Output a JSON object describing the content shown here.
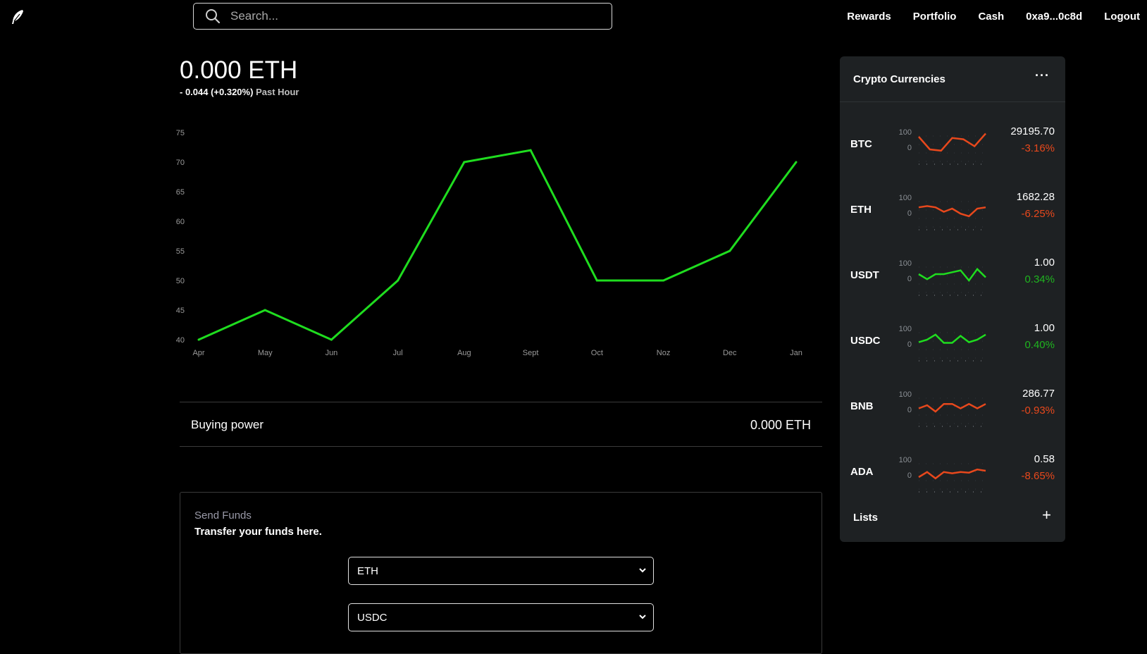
{
  "search": {
    "placeholder": "Search..."
  },
  "nav": [
    "Rewards",
    "Portfolio",
    "Cash",
    "0xa9...0c8d",
    "Logout"
  ],
  "balance": {
    "amount": "0.000 ETH",
    "change": "- 0.044 (+0.320%)",
    "period": "Past Hour"
  },
  "colors": {
    "up": "#1fdd1f",
    "down": "#e8481c",
    "background": "#000000",
    "panel": "#1e2123"
  },
  "chart_data": {
    "type": "line",
    "x": [
      "Apr",
      "May",
      "Jun",
      "Jul",
      "Aug",
      "Sept",
      "Oct",
      "Noz",
      "Dec",
      "Jan"
    ],
    "values": [
      40,
      45,
      40,
      50,
      70,
      72,
      50,
      50,
      55,
      70
    ],
    "yticks": [
      40,
      45,
      50,
      55,
      60,
      65,
      70,
      75
    ],
    "ylim": [
      40,
      75
    ],
    "color": "#1fdd1f",
    "grid": false
  },
  "buying_power": {
    "label": "Buying power",
    "value": "0.000 ETH"
  },
  "send_funds": {
    "title": "Send Funds",
    "subtitle": "Transfer your funds here.",
    "from": "ETH",
    "to": "USDC"
  },
  "crypto_panel": {
    "title": "Crypto Currencies",
    "more_icon": "ellipsis-icon",
    "items": [
      {
        "symbol": "BTC",
        "price": "29195.70",
        "change": "-3.16%",
        "trend": "down",
        "spark_labels": [
          "100",
          "0"
        ],
        "spark": [
          70,
          50,
          48,
          68,
          66,
          55,
          75
        ]
      },
      {
        "symbol": "ETH",
        "price": "1682.28",
        "change": "-6.25%",
        "trend": "down",
        "spark_labels": [
          "100",
          "0"
        ],
        "spark": [
          62,
          64,
          62,
          55,
          60,
          52,
          48,
          60,
          62
        ]
      },
      {
        "symbol": "USDT",
        "price": "1.00",
        "change": "0.34%",
        "trend": "up",
        "spark_labels": [
          "100",
          "0"
        ],
        "spark": [
          60,
          52,
          60,
          60,
          63,
          66,
          50,
          68,
          55
        ]
      },
      {
        "symbol": "USDC",
        "price": "1.00",
        "change": "0.40%",
        "trend": "up",
        "spark_labels": [
          "100",
          "0"
        ],
        "spark": [
          56,
          60,
          68,
          55,
          55,
          66,
          56,
          60,
          68
        ]
      },
      {
        "symbol": "BNB",
        "price": "286.77",
        "change": "-0.93%",
        "trend": "down",
        "spark_labels": [
          "100",
          "0"
        ],
        "spark": [
          55,
          60,
          50,
          62,
          62,
          55,
          62,
          55,
          62
        ]
      },
      {
        "symbol": "ADA",
        "price": "0.58",
        "change": "-8.65%",
        "trend": "down",
        "spark_labels": [
          "100",
          "0"
        ],
        "spark": [
          50,
          58,
          48,
          58,
          56,
          58,
          57,
          62,
          60
        ]
      }
    ],
    "lists_label": "Lists",
    "add_icon": "plus-icon"
  }
}
